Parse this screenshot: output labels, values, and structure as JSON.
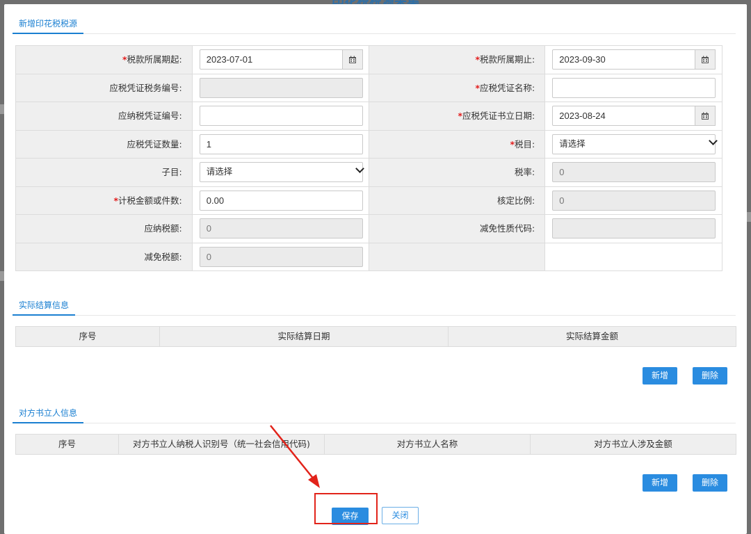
{
  "background": {
    "title": "印花税税源采集"
  },
  "sections": {
    "main": "新增印花税税源",
    "settlement": "实际结算信息",
    "counterparty": "对方书立人信息"
  },
  "form": {
    "rows": [
      {
        "left": {
          "required": true,
          "label": "税款所属期起:",
          "type": "date",
          "value": "2023-07-01"
        },
        "right": {
          "required": true,
          "label": "税款所属期止:",
          "type": "date",
          "value": "2023-09-30"
        }
      },
      {
        "left": {
          "required": false,
          "label": "应税凭证税务编号:",
          "type": "disabled",
          "value": ""
        },
        "right": {
          "required": true,
          "label": "应税凭证名称:",
          "type": "text",
          "value": ""
        }
      },
      {
        "left": {
          "required": false,
          "label": "应纳税凭证编号:",
          "type": "text",
          "value": ""
        },
        "right": {
          "required": true,
          "label": "应税凭证书立日期:",
          "type": "date",
          "value": "2023-08-24"
        }
      },
      {
        "left": {
          "required": false,
          "label": "应税凭证数量:",
          "type": "text",
          "value": "1"
        },
        "right": {
          "required": true,
          "label": "税目:",
          "type": "select",
          "value": "请选择"
        }
      },
      {
        "left": {
          "required": false,
          "label": "子目:",
          "type": "select",
          "value": "请选择"
        },
        "right": {
          "required": false,
          "label": "税率:",
          "type": "disabled",
          "value": "0"
        }
      },
      {
        "left": {
          "required": true,
          "label": "计税金额或件数:",
          "type": "text",
          "value": "0.00"
        },
        "right": {
          "required": false,
          "label": "核定比例:",
          "type": "disabled",
          "value": "0"
        }
      },
      {
        "left": {
          "required": false,
          "label": "应纳税额:",
          "type": "disabled",
          "value": "0"
        },
        "right": {
          "required": false,
          "label": "减免性质代码:",
          "type": "disabled",
          "value": ""
        }
      },
      {
        "left": {
          "required": false,
          "label": "减免税额:",
          "type": "disabled",
          "value": "0"
        },
        "right": null
      }
    ]
  },
  "settlement_table": {
    "columns": [
      "序号",
      "实际结算日期",
      "实际结算金额"
    ]
  },
  "counterparty_table": {
    "columns": [
      "序号",
      "对方书立人纳税人识别号（统一社会信用代码)",
      "对方书立人名称",
      "对方书立人涉及金额"
    ]
  },
  "buttons": {
    "add": "新增",
    "delete": "删除",
    "save": "保存",
    "close": "关闭"
  },
  "icons": {
    "calendar": "calendar-icon",
    "dropdown": "chevron-down-icon"
  },
  "colors": {
    "accent": "#1a7fd1",
    "required": "#e21c1c",
    "highlight": "#e2231a"
  }
}
